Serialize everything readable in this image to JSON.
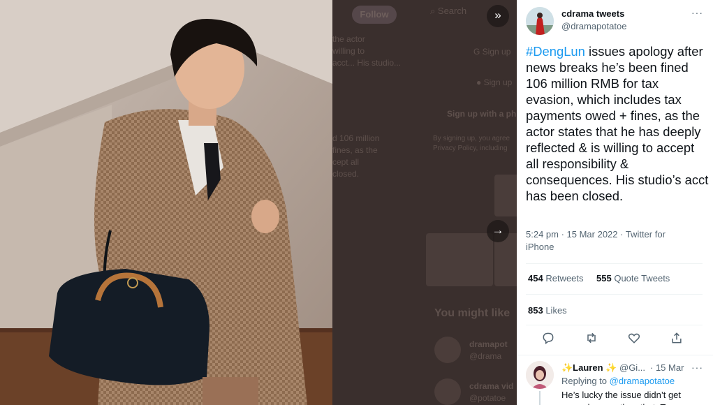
{
  "backdrop": {
    "follow_label": "Follow",
    "search_label": "Search",
    "snippet_1": [
      "the actor",
      "willing to",
      "acct... His studio..."
    ],
    "snippet_2": [
      "d 106 million",
      "fines, as the",
      "cept all",
      "closed."
    ],
    "signup_google": "Sign up",
    "signup_apple": "Sign up",
    "signup_phone": "Sign up with a ph",
    "terms": [
      "By signing up, you agree",
      "Privacy Policy, including"
    ],
    "you_might_like": "You might like",
    "suggest_1_name": "dramapot",
    "suggest_1_handle": "@drama",
    "suggest_2_name": "cdrama vid",
    "suggest_2_handle": "@potatoe"
  },
  "viewer": {
    "collapse_icon": "chevrons-right-icon",
    "next_icon": "arrow-right-icon"
  },
  "tweet": {
    "author_name": "cdrama tweets",
    "author_handle": "@dramapotatoe",
    "more_label": "···",
    "hashtag": "#DengLun",
    "body": " issues apology after news breaks he’s been fined 106 million RMB for tax evasion, which includes tax payments owed + fines, as the actor states that he has deeply reflected & is willing to accept all responsibility & consequences. His studio’s acct has been closed.",
    "meta": "5:24 pm · 15 Mar 2022 · Twitter for iPhone",
    "retweets_count": "454",
    "retweets_label": "Retweets",
    "quotes_count": "555",
    "quotes_label": "Quote Tweets",
    "likes_count": "853",
    "likes_label": "Likes",
    "actions": [
      "reply-icon",
      "retweet-icon",
      "like-icon",
      "share-icon"
    ]
  },
  "reply": {
    "name": "✨Lauren ✨",
    "handle": "@Gi...",
    "date": "· 15 Mar",
    "more_label": "···",
    "replying_prefix": "Replying to ",
    "replying_to": "@dramapotatoe",
    "text": "He’s lucky the issue didn’t get more damage than that. Tax"
  },
  "colors": {
    "accent": "#1d9bf0",
    "text_primary": "#0f1419",
    "text_secondary": "#536471",
    "divider": "#eff3f4"
  }
}
